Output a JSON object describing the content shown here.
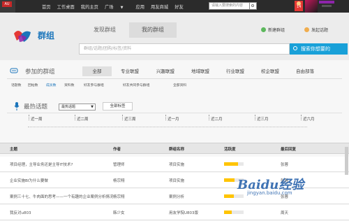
{
  "topbar": {
    "badge": "AU",
    "nav": [
      "首页",
      "工作桌面",
      "我的主页",
      "广场",
      "应用",
      "用友商城",
      "好友"
    ],
    "search_placeholder": "请输入要搜索的内容",
    "badge_count": "14"
  },
  "header": {
    "logo_text": "群组",
    "tabs": [
      "发现群组",
      "我的群组"
    ],
    "new_group": "新建群组",
    "new_topic": "发起话题",
    "search_placeholder": "群组/话题/团购/标签/资料",
    "search_button": "搜索你想要的"
  },
  "joined": {
    "title": "参加的群组",
    "categories": [
      "全部",
      "专业联盟",
      "兴趣联盟",
      "地域联盟",
      "行业联盟",
      "校企联盟",
      "自由部落"
    ],
    "subtabs": [
      "话题数",
      "回帖数",
      "成员数",
      "资料数",
      "好友参与群组",
      "好友共同参与群组",
      "全部资料"
    ]
  },
  "hot": {
    "title": "最热话题",
    "select_value": "最热话题",
    "button": "全部标签",
    "timeline": [
      "近一周",
      "近二周",
      "近三周",
      "近一月",
      "近二月",
      "近三月",
      "近六月"
    ]
  },
  "table": {
    "headers": [
      "主题",
      "作者",
      "群组名称",
      "活跃度",
      "最后回复"
    ],
    "rows": [
      {
        "title": "项目经理，主导业务还是主导IT技术?",
        "author": "管理师",
        "group": "项目实施",
        "activity": 0.7,
        "last": "张蓉"
      },
      {
        "title": "企业实施BI为什么要做",
        "author": "杨宗翔",
        "group": "项目实施",
        "activity": 0.55,
        "last": "张蓉"
      },
      {
        "title": "案例三十七、牛肉面的思考——一个有趣的企业案例分析情况",
        "author": "杨宗翔",
        "group": "案例分析",
        "activity": 0.5,
        "last": "张蓉"
      },
      {
        "title": "我反对u803",
        "author": "韩少女",
        "group": "用友学院U803版",
        "activity": 0.4,
        "last": "周天"
      }
    ]
  },
  "watermark": {
    "brand": "Baidu经验",
    "url": "jingyan.baidu.com"
  },
  "colors": {
    "accent": "#18a0d8",
    "activity": "#ffc400",
    "logo": "#1b75bb"
  }
}
